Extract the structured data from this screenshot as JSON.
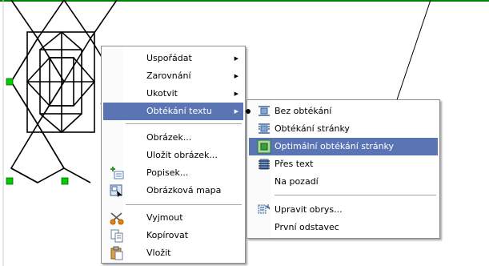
{
  "context_menu": {
    "items": [
      {
        "label": "Uspořádat",
        "has_submenu": true
      },
      {
        "label": "Zarovnání",
        "has_submenu": true
      },
      {
        "label": "Ukotvit",
        "has_submenu": true
      },
      {
        "label": "Obtékání textu",
        "has_submenu": true,
        "highlighted": true
      },
      {
        "label": "Obrázek...",
        "has_submenu": false
      },
      {
        "label": "Uložit obrázek...",
        "has_submenu": false
      },
      {
        "label": "Popisek...",
        "has_submenu": false,
        "icon": "caption-icon"
      },
      {
        "label": "Obrázková mapa",
        "has_submenu": false,
        "icon": "image-map-icon"
      },
      {
        "label": "Vyjmout",
        "has_submenu": false,
        "icon": "scissors-icon"
      },
      {
        "label": "Kopírovat",
        "has_submenu": false,
        "icon": "copy-icon"
      },
      {
        "label": "Vložit",
        "has_submenu": false,
        "icon": "paste-icon"
      }
    ]
  },
  "wrap_submenu": {
    "items": [
      {
        "label": "Bez obtékání",
        "icon": "wrap-off-icon",
        "selected": true
      },
      {
        "label": "Obtékání stránky",
        "icon": "wrap-page-icon"
      },
      {
        "label": "Optimální obtékání stránky",
        "icon": "wrap-optimal-icon",
        "highlighted": true
      },
      {
        "label": "Přes text",
        "icon": "wrap-through-icon"
      },
      {
        "label": "Na pozadí",
        "icon": ""
      },
      {
        "label": "Upravit obrys...",
        "icon": "edit-contour-icon"
      },
      {
        "label": "První odstavec",
        "icon": ""
      }
    ]
  },
  "colors": {
    "highlight": "#5b74b4",
    "selection_handle": "#00cc00",
    "page_border": "#008000"
  }
}
